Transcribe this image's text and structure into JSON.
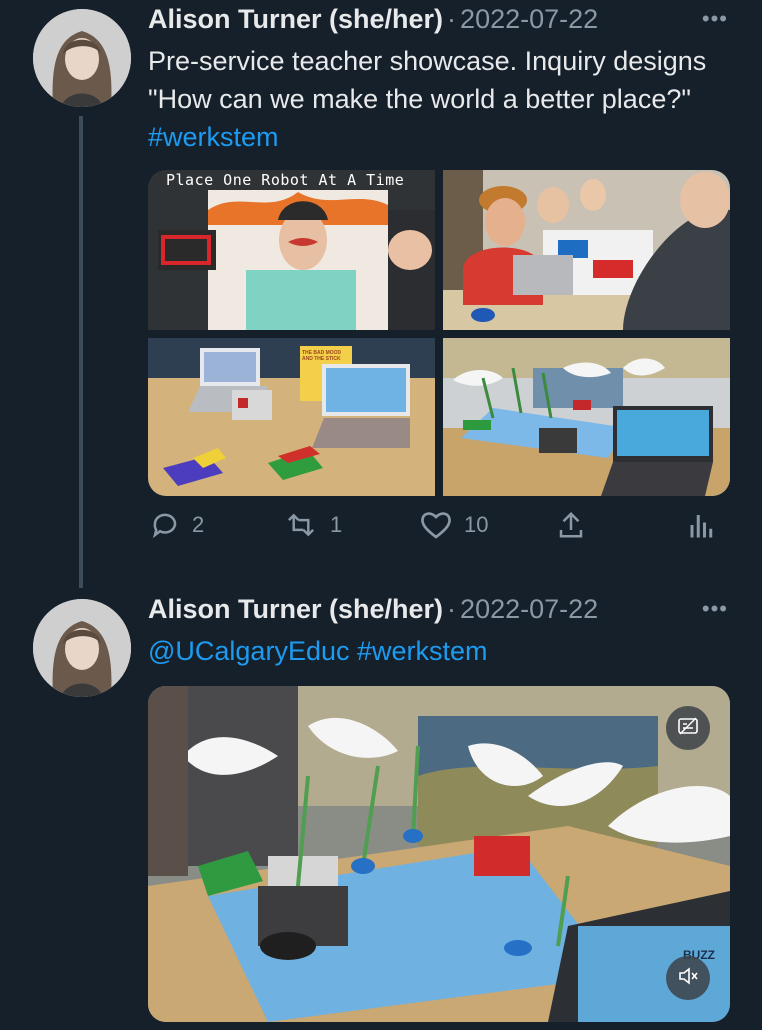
{
  "tweets": [
    {
      "author": "Alison Turner (she/her)",
      "separator": "·",
      "date": "2022-07-22",
      "more": "•••",
      "text_plain": "Pre-service teacher showcase. Inquiry designs \"How can we make the world a better place?\"",
      "hashtag": "#werkstem",
      "media": {
        "photo1_sign": "Place One Robot At A Time",
        "photo3_book": "THE BAD MOOD AND THE STICK"
      },
      "stats": {
        "replies": "2",
        "retweets": "1",
        "likes": "10"
      }
    },
    {
      "author": "Alison Turner (she/her)",
      "separator": "·",
      "date": "2022-07-22",
      "more": "•••",
      "mention": "@UCalgaryEduc",
      "hashtag": "#werkstem",
      "video": {
        "screen_text": "BUZZ"
      }
    }
  ],
  "icons": [
    "reply-icon",
    "retweet-icon",
    "like-icon",
    "share-icon",
    "analytics-icon",
    "captions-icon",
    "mute-icon"
  ],
  "colors": {
    "background": "#15202b",
    "link": "#1d9bf0",
    "secondary": "#8b98a5",
    "thread_line": "#3d4c5a"
  }
}
